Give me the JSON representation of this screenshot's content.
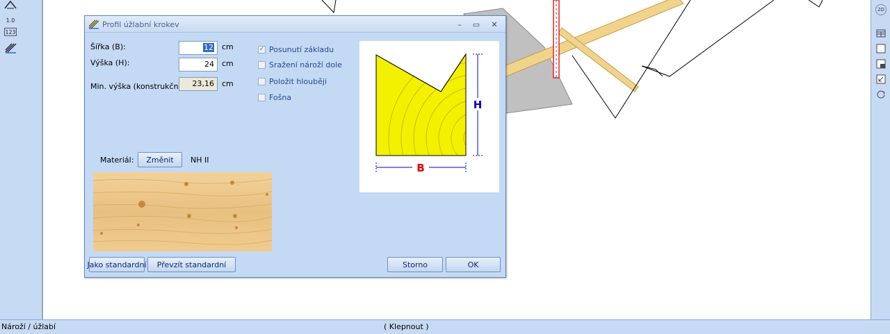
{
  "status": {
    "left": "Nároží / úžlabí",
    "center": "( Klepnout )"
  },
  "dialog": {
    "title": "Profil úžlabní krokev",
    "minimize_glyph": "–",
    "maximize_glyph": "▭",
    "close_glyph": "✕",
    "width_label": "Šířka (B):",
    "width_value": "12",
    "height_label": "Výška (H):",
    "height_value": "24",
    "minheight_label": "Min. výška (konstrukční):",
    "minheight_value": "23,16",
    "unit": "cm",
    "checkboxes": [
      {
        "label": "Posunutí základu",
        "checked": true
      },
      {
        "label": "Sražení nároží dole",
        "checked": false
      },
      {
        "label": "Položit hlouběji",
        "checked": false
      },
      {
        "label": "Fošna",
        "checked": false
      }
    ],
    "material_label": "Materiál:",
    "change_button": "Změnit",
    "material_value": "NH II",
    "diagram_h": "H",
    "diagram_b": "B",
    "buttons": {
      "as_standard": "Jako standardní",
      "take_standard": "Převzít standardní",
      "cancel": "Storno",
      "ok": "OK"
    }
  },
  "left_toolbar": {
    "items": [
      {
        "icon": "roof-tool-icon"
      },
      {
        "icon": "dimension-tool-icon",
        "label": "1.0"
      },
      {
        "icon": "numbering-tool-icon",
        "label": "123"
      },
      {
        "icon": "hatch-tool-icon"
      }
    ]
  },
  "right_toolbar": {
    "items": [
      {
        "icon": "view-2d-icon",
        "label": "2D"
      },
      {
        "icon": "layers-icon"
      },
      {
        "icon": "frame-icon"
      },
      {
        "icon": "window-icon"
      },
      {
        "icon": "zoom-icon"
      },
      {
        "icon": "refresh-icon"
      }
    ]
  },
  "colors": {
    "panel": "#c4d9f4",
    "accent_red": "#e00000",
    "accent_blue": "#0000cc",
    "wood_profile": "#f3f000"
  }
}
